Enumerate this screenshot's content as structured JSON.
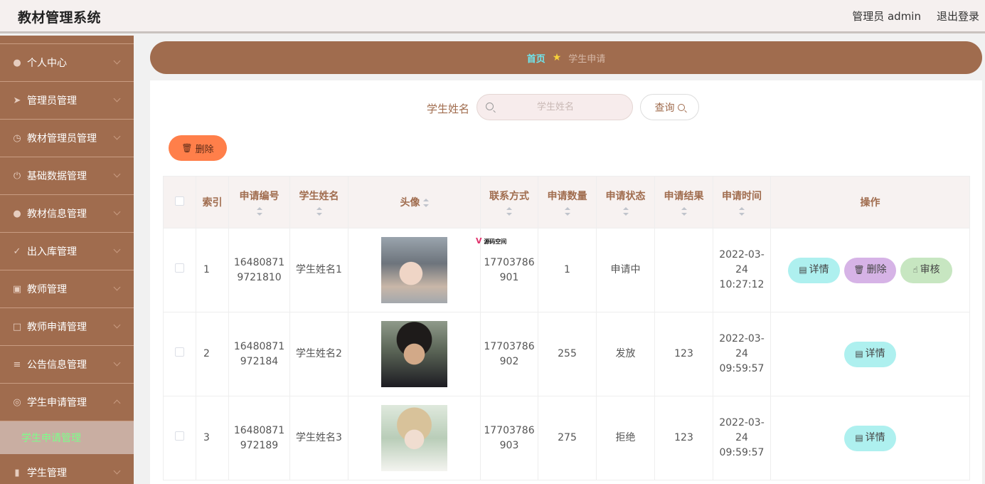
{
  "header": {
    "title": "教材管理系统",
    "user": "管理员 admin",
    "logout": "退出登录"
  },
  "sidebar": {
    "items": [
      {
        "label": "个人中心",
        "icon": "user-icon"
      },
      {
        "label": "管理员管理",
        "icon": "send-icon"
      },
      {
        "label": "教材管理员管理",
        "icon": "clock-icon"
      },
      {
        "label": "基础数据管理",
        "icon": "power-icon"
      },
      {
        "label": "教材信息管理",
        "icon": "bulb-icon"
      },
      {
        "label": "出入库管理",
        "icon": "plane-icon"
      },
      {
        "label": "教师管理",
        "icon": "clipboard-icon"
      },
      {
        "label": "教师申请管理",
        "icon": "copy-icon"
      },
      {
        "label": "公告信息管理",
        "icon": "sliders-icon"
      },
      {
        "label": "学生申请管理",
        "icon": "help-icon"
      },
      {
        "label": "学生管理",
        "icon": "mic-icon"
      }
    ],
    "submenu": "学生申请管理"
  },
  "breadcrumb": {
    "home": "首页",
    "current": "学生申请"
  },
  "search": {
    "label": "学生姓名",
    "placeholder": "学生姓名",
    "button": "查询"
  },
  "toolbar": {
    "delete": "删除"
  },
  "table": {
    "headers": {
      "index": "索引",
      "no": "申请编号",
      "name": "学生姓名",
      "avatar": "头像",
      "phone": "联系方式",
      "qty": "申请数量",
      "status": "申请状态",
      "result": "申请结果",
      "time": "申请时间",
      "ops": "操作"
    },
    "rows": [
      {
        "index": "1",
        "no": "16480871 9721810",
        "name": "学生姓名1",
        "phone": "17703786 901",
        "qty": "1",
        "status": "申请中",
        "result": "",
        "time": "2022-03-24 10:27:12",
        "ops": [
          "详情",
          "删除",
          "审核"
        ]
      },
      {
        "index": "2",
        "no": "16480871 972184",
        "name": "学生姓名2",
        "phone": "17703786 902",
        "qty": "255",
        "status": "发放",
        "result": "123",
        "time": "2022-03-24 09:59:57",
        "ops": [
          "详情"
        ]
      },
      {
        "index": "3",
        "no": "16480871 972189",
        "name": "学生姓名3",
        "phone": "17703786 903",
        "qty": "275",
        "status": "拒绝",
        "result": "123",
        "time": "2022-03-24 09:59:57",
        "ops": [
          "详情"
        ]
      }
    ]
  },
  "watermark": "源码空间"
}
